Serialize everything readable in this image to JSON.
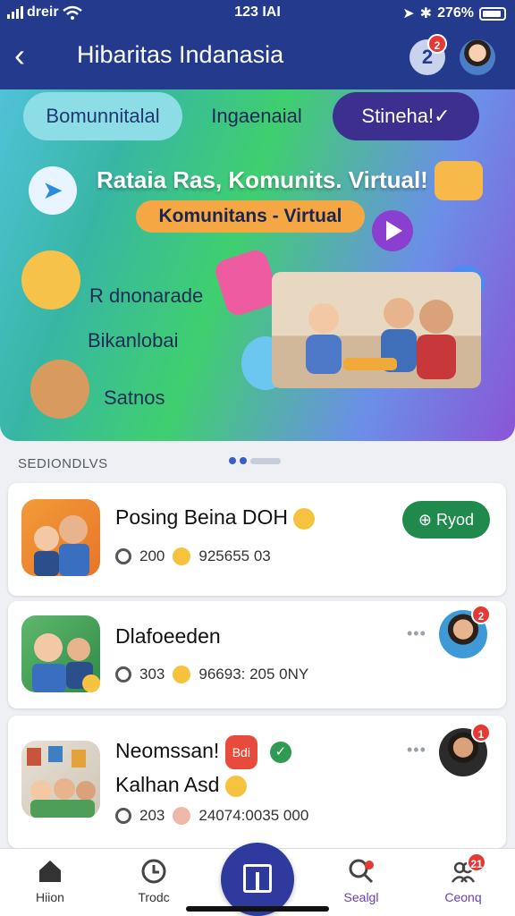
{
  "status_bar": {
    "carrier": "dreir",
    "time": "123 IAI",
    "battery": "276%"
  },
  "header": {
    "title": "Hibaritas Indanasia",
    "notifications_badge": "2",
    "notification_glyph": "2"
  },
  "hero": {
    "tabs": [
      {
        "label": "Bomunnitalal",
        "active": true
      },
      {
        "label": "Ingaenaial",
        "active": false
      },
      {
        "label": "Stineha!✓",
        "active": false
      }
    ],
    "headline": "Rataia Ras, Komunits. Virtual!",
    "pill": "Komunitans - Virtual",
    "menu": [
      "R dnonarade",
      "Bikanlobai",
      "Satnos"
    ],
    "dots": {
      "count": 2,
      "active": 0
    }
  },
  "section_label": "SEDIONDLVS",
  "cards": [
    {
      "title": "Posing Beina DOH",
      "count": "200",
      "info": "925655 03",
      "action": "Ryod"
    },
    {
      "title": "Dlafoeeden",
      "count": "303",
      "info": "96693: 205 0NY",
      "avatar_badge": "2"
    },
    {
      "title_line1": "Neomssan!",
      "tag": "Bdi",
      "title_line2": "Kalhan Asd",
      "count": "203",
      "info": "24074:0035 000",
      "avatar_badge": "1"
    }
  ],
  "bottom_nav": [
    {
      "label": "Hiion",
      "icon": "home-icon"
    },
    {
      "label": "Trodc",
      "icon": "clock-icon"
    },
    {
      "label": "Sealgl",
      "icon": "search-icon"
    },
    {
      "label": "Ceonq",
      "icon": "people-icon",
      "badge": "21"
    }
  ],
  "colors": {
    "header": "#243a8c",
    "accent": "#2f3a9f",
    "join": "#1f8a4c",
    "badge": "#e53935"
  }
}
